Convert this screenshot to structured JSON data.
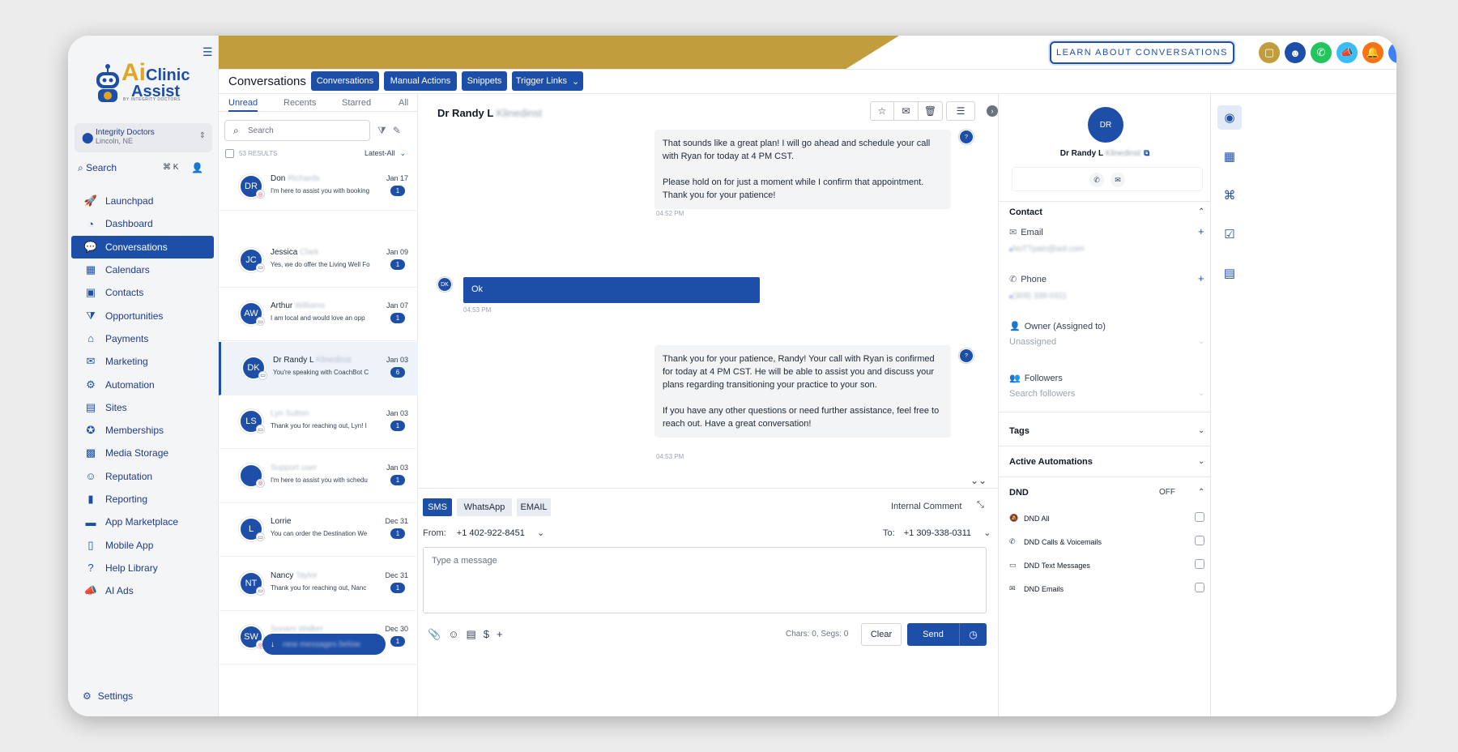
{
  "brand": {
    "ai": "Ai",
    "line1": "Clinic",
    "line2": "Assist",
    "tagline": "BY INTEGRITY DOCTORS"
  },
  "location": {
    "name": "Integrity Doctors",
    "sub": "Lincoln, NE"
  },
  "sidebar": {
    "search_label": "Search",
    "search_shortcut": "⌘ K",
    "items": [
      {
        "label": "Launchpad",
        "icon": "rocket-icon",
        "glyph": "🚀"
      },
      {
        "label": "Dashboard",
        "icon": "gauge-icon",
        "glyph": "◔"
      },
      {
        "label": "Conversations",
        "icon": "chat-icon",
        "glyph": "💬",
        "active": true
      },
      {
        "label": "Calendars",
        "icon": "calendar-icon",
        "glyph": "▦"
      },
      {
        "label": "Contacts",
        "icon": "contacts-icon",
        "glyph": "▣"
      },
      {
        "label": "Opportunities",
        "icon": "filter-icon",
        "glyph": "⧩"
      },
      {
        "label": "Payments",
        "icon": "payments-icon",
        "glyph": "⌂"
      },
      {
        "label": "Marketing",
        "icon": "mail-icon",
        "glyph": "✉"
      },
      {
        "label": "Automation",
        "icon": "automation-icon",
        "glyph": "⚙"
      },
      {
        "label": "Sites",
        "icon": "sites-icon",
        "glyph": "▤"
      },
      {
        "label": "Memberships",
        "icon": "award-icon",
        "glyph": "✪"
      },
      {
        "label": "Media Storage",
        "icon": "image-icon",
        "glyph": "▩"
      },
      {
        "label": "Reputation",
        "icon": "smile-icon",
        "glyph": "☺"
      },
      {
        "label": "Reporting",
        "icon": "bar-chart-icon",
        "glyph": "▮"
      },
      {
        "label": "App Marketplace",
        "icon": "briefcase-icon",
        "glyph": "▬"
      },
      {
        "label": "Mobile App",
        "icon": "phone-icon",
        "glyph": "▯"
      },
      {
        "label": "Help Library",
        "icon": "question-icon",
        "glyph": "?"
      },
      {
        "label": "AI Ads",
        "icon": "megaphone-icon",
        "glyph": "📣"
      }
    ],
    "settings_label": "Settings"
  },
  "header": {
    "learn_label": "LEARN ABOUT CONVERSATIONS",
    "icons": [
      {
        "name": "chat-bubble-icon",
        "glyph": "▢",
        "color": "#c19d3d"
      },
      {
        "name": "robot-icon",
        "glyph": "☻",
        "color": "#1e4fa8"
      },
      {
        "name": "call-icon",
        "glyph": "✆",
        "color": "#22c55e"
      },
      {
        "name": "megaphone-icon",
        "glyph": "📣",
        "color": "#38bdf8"
      },
      {
        "name": "bell-icon",
        "glyph": "🔔",
        "color": "#f97316"
      },
      {
        "name": "help-icon",
        "glyph": "?",
        "color": "#3b82f6"
      },
      {
        "name": "profile-avatar",
        "glyph": "●",
        "color": "#7c5b3a"
      }
    ]
  },
  "tabbar": {
    "title": "Conversations",
    "tabs": [
      "Conversations",
      "Manual Actions",
      "Snippets",
      "Trigger Links"
    ]
  },
  "list": {
    "filters": [
      "Unread",
      "Recents",
      "Starred",
      "All"
    ],
    "search_placeholder": "Search",
    "results": "53 RESULTS",
    "sort": "Latest-All",
    "conversations": [
      {
        "initials": "DR",
        "first": "Don",
        "last": "Richards",
        "date": "Jan 17",
        "preview": "I'm here to assist you with booking",
        "count": "1",
        "channel": "instagram"
      },
      {
        "initials": "JC",
        "first": "Jessica",
        "last": "Clark",
        "date": "Jan 09",
        "preview": "Yes, we do offer the Living Well Fo",
        "count": "1",
        "channel": "sms"
      },
      {
        "initials": "AW",
        "first": "Arthur",
        "last": "Williams",
        "date": "Jan 07",
        "preview": "I am local and would love an opp",
        "count": "1",
        "channel": "sms"
      },
      {
        "initials": "DK",
        "first": "Dr Randy L",
        "last": "Klinedinst",
        "date": "Jan 03",
        "preview": "You're speaking with CoachBot C",
        "count": "6",
        "channel": "sms",
        "selected": true
      },
      {
        "initials": "LS",
        "first": "",
        "last": "Lyn Sutton",
        "date": "Jan 03",
        "preview": "Thank you for reaching out, Lyn! I",
        "count": "1",
        "channel": "sms"
      },
      {
        "initials": "",
        "first": "",
        "last": "Support user",
        "date": "Jan 03",
        "preview": "I'm here to assist you with schedu",
        "count": "1",
        "channel": "instagram"
      },
      {
        "initials": "L",
        "first": "Lorrie",
        "last": "",
        "date": "Dec 31",
        "preview": "You can order the Destination We",
        "count": "1",
        "channel": "sms"
      },
      {
        "initials": "NT",
        "first": "Nancy",
        "last": "Taylor",
        "date": "Dec 31",
        "preview": "Thank you for reaching out, Nanc",
        "count": "1",
        "channel": "sms"
      },
      {
        "initials": "SW",
        "first": "",
        "last": "Sonam Walker",
        "date": "Dec 30",
        "preview": "I'm here to assist you with schedu",
        "count": "1",
        "channel": "instagram"
      }
    ],
    "float_pill": "new messages below"
  },
  "chat": {
    "title_first": "Dr Randy L",
    "title_last": "Klinedinst",
    "messages": [
      {
        "type": "out",
        "paragraphs": [
          "That sounds like a great plan! I will go ahead and schedule your call with Ryan for today at 4 PM CST.",
          "Please hold on for just a moment while I confirm that appointment. Thank you for your patience!"
        ],
        "time": "04:52 PM"
      },
      {
        "type": "in",
        "text": "Ok",
        "time": "04:53 PM",
        "avatar": "DK"
      },
      {
        "type": "out",
        "paragraphs": [
          "Thank you for your patience, Randy! Your call with Ryan is confirmed for today at 4 PM CST. He will be able to assist you and discuss your plans regarding transitioning your practice to your son.",
          "If you have any other questions or need further assistance, feel free to reach out. Have a great conversation!"
        ],
        "time": "04:53 PM"
      }
    ],
    "composer": {
      "tabs": [
        "SMS",
        "WhatsApp",
        "EMAIL"
      ],
      "internal_comment": "Internal Comment",
      "from_label": "From:",
      "from_number": "+1 402-922-8451",
      "to_label": "To:",
      "to_number": "+1 309-338-0311",
      "placeholder": "Type a message",
      "chars": "Chars: 0, Segs: 0",
      "clear": "Clear",
      "send": "Send"
    }
  },
  "contact": {
    "initials": "DR",
    "name_first": "Dr Randy L",
    "name_last": "Klinedinst",
    "contact_label": "Contact",
    "email_label": "Email",
    "email_value": "NoTTpain@aol.com",
    "phone_label": "Phone",
    "phone_value": "(309) 338-0311",
    "owner_label": "Owner (Assigned to)",
    "owner_value": "Unassigned",
    "followers_label": "Followers",
    "followers_placeholder": "Search followers",
    "tags_label": "Tags",
    "automations_label": "Active Automations",
    "dnd_label": "DND",
    "dnd_status": "OFF",
    "dnd_items": [
      "DND All",
      "DND Calls & Voicemails",
      "DND Text Messages",
      "DND Emails"
    ]
  },
  "colors": {
    "primary": "#1e4fa8",
    "gold": "#c19d3d",
    "accent_orange": "#e0a621"
  }
}
